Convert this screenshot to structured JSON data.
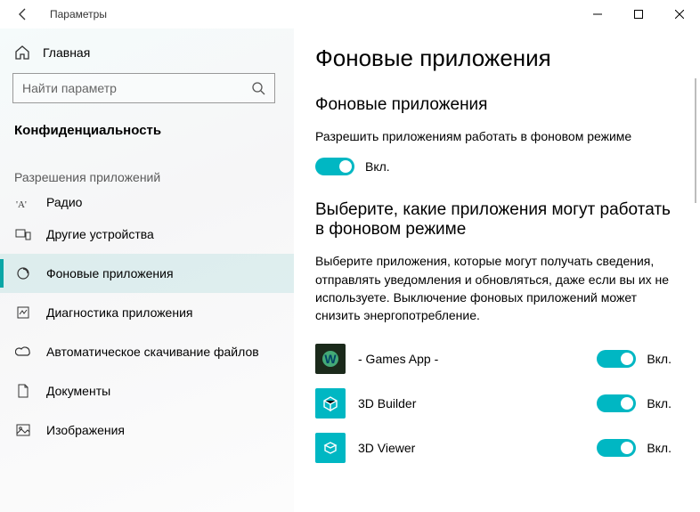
{
  "window": {
    "title": "Параметры"
  },
  "sidebar": {
    "home": "Главная",
    "search_placeholder": "Найти параметр",
    "category": "Конфиденциальность",
    "subhead": "Разрешения приложений",
    "items": [
      {
        "label": "Радио"
      },
      {
        "label": "Другие устройства"
      },
      {
        "label": "Фоновые приложения"
      },
      {
        "label": "Диагностика приложения"
      },
      {
        "label": "Автоматическое скачивание файлов"
      },
      {
        "label": "Документы"
      },
      {
        "label": "Изображения"
      }
    ]
  },
  "main": {
    "heading": "Фоновые приложения",
    "section1_title": "Фоновые приложения",
    "section1_desc": "Разрешить приложениям работать в фоновом режиме",
    "section1_state": "Вкл.",
    "section2_title": "Выберите, какие приложения могут работать в фоновом режиме",
    "section2_desc": "Выберите приложения, которые могут получать сведения, отправлять уведомления и обновляться, даже если вы их не используете. Выключение фоновых приложений может снизить энергопотребление.",
    "apps": [
      {
        "name": "- Games App -",
        "state": "Вкл."
      },
      {
        "name": "3D Builder",
        "state": "Вкл."
      },
      {
        "name": "3D Viewer",
        "state": "Вкл."
      }
    ]
  }
}
